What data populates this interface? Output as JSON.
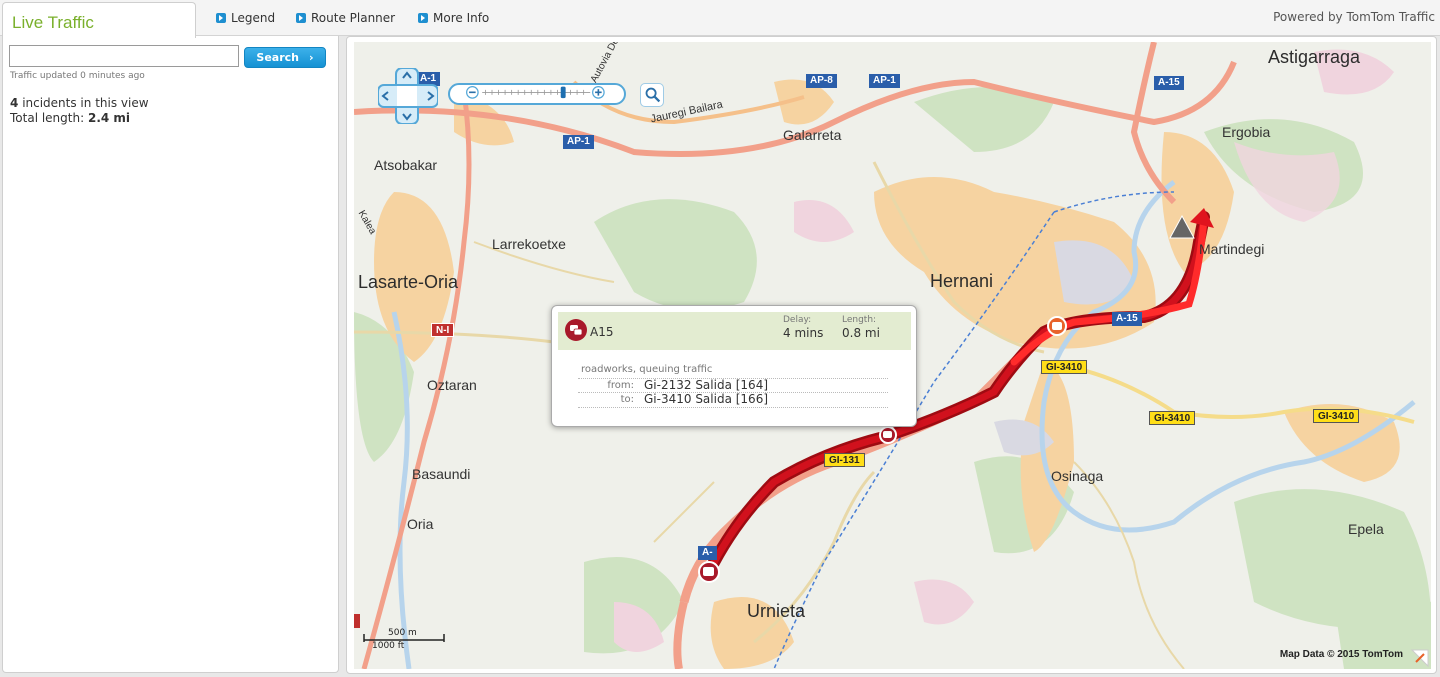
{
  "tabs": {
    "active": "Live Traffic",
    "links": [
      "Legend",
      "Route Planner",
      "More Info"
    ],
    "powered_by": "Powered by TomTom Traffic"
  },
  "sidebar": {
    "search_value": "",
    "search_label": "Search",
    "updated": "Traffic updated 0 minutes ago",
    "incident_count": "4",
    "incident_text": "incidents in this view",
    "total_label": "Total length:",
    "total_value": "2.4 mi"
  },
  "map": {
    "places": {
      "astigarraga": "Astigarraga",
      "ergobia": "Ergobia",
      "martindegi": "Martindegi",
      "hernani": "Hernani",
      "galarreta": "Galarreta",
      "atsobakar": "Atsobakar",
      "larrekoetxe": "Larrekoetxe",
      "lasarte": "Lasarte-Oria",
      "oztaran": "Oztaran",
      "basaundi": "Basaundi",
      "oria": "Oria",
      "osinaga": "Osinaga",
      "epela": "Epela",
      "urnieta": "Urnieta",
      "autovia": "Autovia Del",
      "jauregi": "Jauregi Bailara",
      "kalea": "Kalea"
    },
    "shields": {
      "ap1_left": "AP-1",
      "ap1_mid": "AP-1",
      "ap8": "AP-8",
      "ap1_top": "AP-1",
      "a15_top": "A-15",
      "a15_mid": "A-15",
      "a1_topleft": "A-1",
      "n1": "N-I",
      "gi3410_a": "GI-3410",
      "gi3410_b": "GI-3410",
      "gi3410_c": "GI-3410",
      "gi131": "GI-131",
      "a15_bottom": "A-"
    },
    "scale": {
      "metric": "500 m",
      "imperial": "1000 ft"
    },
    "attribution": "Map Data © 2015 TomTom",
    "colors": {
      "jam": "#c8101a",
      "jam_light": "#ff2b2b",
      "incident_marker": "#a8192a",
      "incident_orange": "#e8622a"
    }
  },
  "popup": {
    "road": "A15",
    "delay_label": "Delay:",
    "delay_value": "4 mins",
    "length_label": "Length:",
    "length_value": "0.8 mi",
    "description": "roadworks, queuing traffic",
    "from_label": "from:",
    "from_value": "Gi-2132 Salida [164]",
    "to_label": "to:",
    "to_value": "Gi-3410 Salida [166]"
  }
}
